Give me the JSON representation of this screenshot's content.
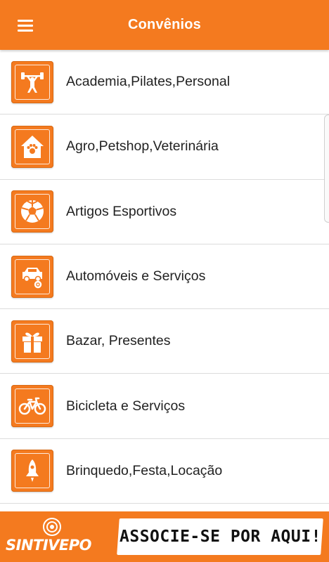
{
  "appbar": {
    "title": "Convênios",
    "menu_icon": "hamburger-menu-icon"
  },
  "colors": {
    "primary": "#f47a1f",
    "text": "#222222",
    "divider": "#dcdcdc"
  },
  "categories": [
    {
      "label": "Academia,Pilates,Personal",
      "icon": "weightlifter-icon"
    },
    {
      "label": "Agro,Petshop,Veterinária",
      "icon": "pet-house-icon"
    },
    {
      "label": "Artigos Esportivos",
      "icon": "soccer-ball-icon"
    },
    {
      "label": "Automóveis e Serviços",
      "icon": "car-service-icon"
    },
    {
      "label": "Bazar, Presentes",
      "icon": "gift-icon"
    },
    {
      "label": "Bicicleta e Serviços",
      "icon": "bicycle-icon"
    },
    {
      "label": "Brinquedo,Festa,Locação",
      "icon": "rocket-toy-icon"
    }
  ],
  "banner": {
    "logo_text": "SINTIVEPO",
    "cta_text": "ASSOCIE-SE POR AQUI!"
  }
}
